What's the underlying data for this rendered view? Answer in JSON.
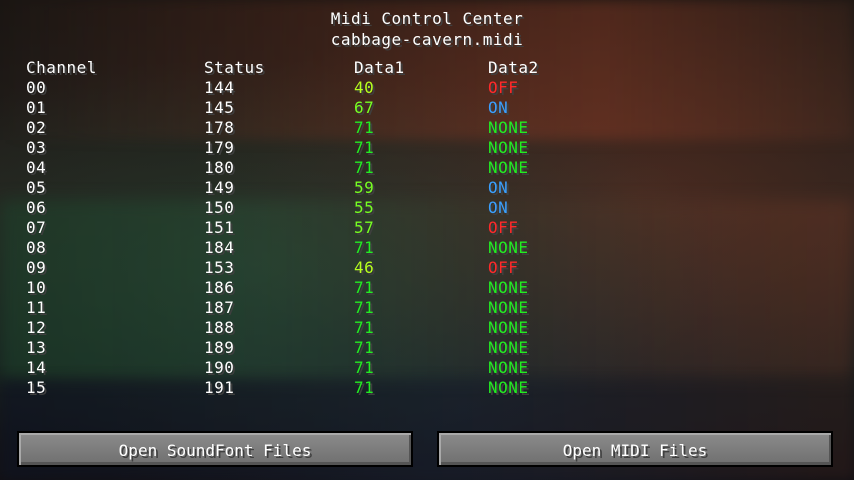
{
  "header": {
    "title": "Midi Control Center",
    "filename": "cabbage-cavern.midi"
  },
  "columns": [
    "Channel",
    "Status",
    "Data1",
    "Data2"
  ],
  "rows": [
    {
      "channel": "00",
      "status": "144",
      "data1": "40",
      "data2": "OFF"
    },
    {
      "channel": "01",
      "status": "145",
      "data1": "67",
      "data2": "ON"
    },
    {
      "channel": "02",
      "status": "178",
      "data1": "71",
      "data2": "NONE"
    },
    {
      "channel": "03",
      "status": "179",
      "data1": "71",
      "data2": "NONE"
    },
    {
      "channel": "04",
      "status": "180",
      "data1": "71",
      "data2": "NONE"
    },
    {
      "channel": "05",
      "status": "149",
      "data1": "59",
      "data2": "ON"
    },
    {
      "channel": "06",
      "status": "150",
      "data1": "55",
      "data2": "ON"
    },
    {
      "channel": "07",
      "status": "151",
      "data1": "57",
      "data2": "OFF"
    },
    {
      "channel": "08",
      "status": "184",
      "data1": "71",
      "data2": "NONE"
    },
    {
      "channel": "09",
      "status": "153",
      "data1": "46",
      "data2": "OFF"
    },
    {
      "channel": "10",
      "status": "186",
      "data1": "71",
      "data2": "NONE"
    },
    {
      "channel": "11",
      "status": "187",
      "data1": "71",
      "data2": "NONE"
    },
    {
      "channel": "12",
      "status": "188",
      "data1": "71",
      "data2": "NONE"
    },
    {
      "channel": "13",
      "status": "189",
      "data1": "71",
      "data2": "NONE"
    },
    {
      "channel": "14",
      "status": "190",
      "data1": "71",
      "data2": "NONE"
    },
    {
      "channel": "15",
      "status": "191",
      "data1": "71",
      "data2": "NONE"
    }
  ],
  "colors": {
    "text": "#ffffff",
    "off": "#ff2a2a",
    "on": "#3aa0ff",
    "none": "#22ee22",
    "data1_low": "#b6ff1e",
    "data1_mid": "#77ff22",
    "data1_high": "#22ee22"
  },
  "buttons": {
    "open_soundfont": "Open SoundFont Files",
    "open_midi": "Open MIDI Files"
  }
}
